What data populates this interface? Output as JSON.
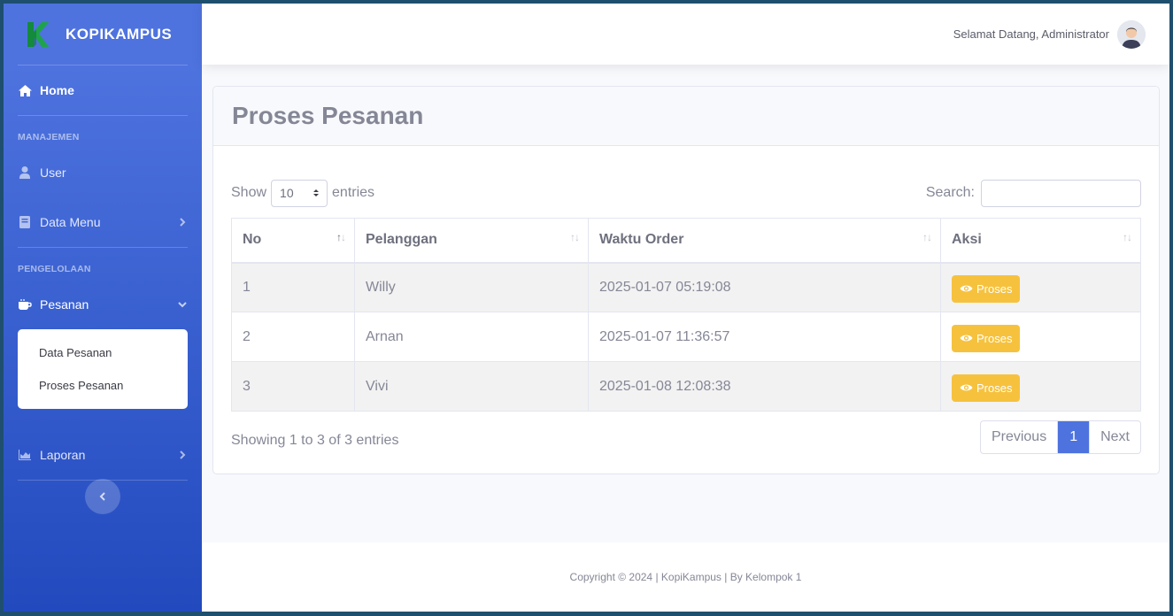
{
  "sidebar": {
    "brand": "KOPIKAMPUS",
    "home": "Home",
    "heading_manage": "MANAJEMEN",
    "user": "User",
    "data_menu": "Data Menu",
    "heading_process": "PENGELOLAAN",
    "orders": "Pesanan",
    "submenu": [
      "Data Pesanan",
      "Proses Pesanan"
    ],
    "reports": "Laporan"
  },
  "topbar": {
    "welcome": "Selamat Datang, Administrator"
  },
  "page": {
    "title": "Proses Pesanan",
    "show_label": "Show",
    "entries_label": "entries",
    "page_length": "10",
    "search_label": "Search:",
    "search_value": ""
  },
  "table": {
    "headers": [
      "No",
      "Pelanggan",
      "Waktu Order",
      "Aksi"
    ],
    "rows": [
      {
        "no": "1",
        "customer": "Willy",
        "time": "2025-01-07 05:19:08",
        "action": "Proses"
      },
      {
        "no": "2",
        "customer": "Arnan",
        "time": "2025-01-07 11:36:57",
        "action": "Proses"
      },
      {
        "no": "3",
        "customer": "Vivi",
        "time": "2025-01-08 12:08:38",
        "action": "Proses"
      }
    ]
  },
  "pager": {
    "info": "Showing 1 to 3 of 3 entries",
    "previous": "Previous",
    "current": "1",
    "next": "Next"
  },
  "footer": {
    "text": "Copyright © 2024 | KopiKampus | By Kelompok 1"
  },
  "colors": {
    "primary": "#4e73df",
    "warning": "#f6c23e",
    "logo_green": "#1fa34a"
  }
}
